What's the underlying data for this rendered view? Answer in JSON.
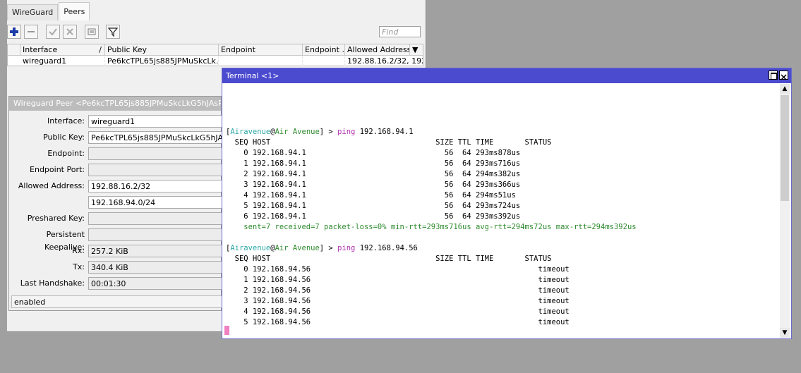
{
  "tabs": [
    "WireGuard",
    "Peers"
  ],
  "active_tab": "Peers",
  "toolbar": {
    "find_placeholder": "Find"
  },
  "table": {
    "columns": [
      "Interface",
      "Public Key",
      "Endpoint",
      "Endpoint ...",
      "Allowed Address"
    ],
    "rows": [
      [
        "wireguard1",
        "Pe6kcTPL65js885JPMuSkcLk...",
        "",
        "",
        "192.88.16.2/32, 192..."
      ]
    ]
  },
  "peer": {
    "title": "Wireguard Peer <Pe6kcTPL65js885JPMuSkcLkG5hJAsR3el/",
    "fields": [
      {
        "label": "Interface:",
        "value": "wireguard1"
      },
      {
        "label": "Public Key:",
        "value": "Pe6kcTPL65js885JPMuSkcLkG5hJAsR"
      },
      {
        "label": "Endpoint:",
        "value": ""
      },
      {
        "label": "Endpoint Port:",
        "value": ""
      },
      {
        "label": "Allowed Address:",
        "value": "192.88.16.2/32"
      },
      {
        "label": "",
        "value": "192.168.94.0/24"
      },
      {
        "label": "Preshared Key:",
        "value": ""
      },
      {
        "label": "Persistent Keepalive:",
        "value": ""
      },
      {
        "label": "Rx:",
        "value": "257.2 KiB"
      },
      {
        "label": "Tx:",
        "value": "340.4 KiB"
      },
      {
        "label": "Last Handshake:",
        "value": "00:01:30"
      }
    ],
    "status": "enabled"
  },
  "terminal": {
    "title": "Terminal <1>",
    "prompt_user": "Airavenue",
    "prompt_host": "Air Avenue",
    "cmd1": "ping 192.168.94.1",
    "header1": "  SEQ HOST                                     SIZE TTL TIME       STATUS",
    "rows1": [
      "    0 192.168.94.1                               56  64 293ms878us",
      "    1 192.168.94.1                               56  64 293ms716us",
      "    2 192.168.94.1                               56  64 294ms382us",
      "    3 192.168.94.1                               56  64 293ms366us",
      "    4 192.168.94.1                               56  64 294ms51us",
      "    5 192.168.94.1                               56  64 293ms724us",
      "    6 192.168.94.1                               56  64 293ms392us"
    ],
    "summary": "    sent=7 received=7 packet-loss=0% min-rtt=293ms716us avg-rtt=294ms72us max-rtt=294ms392us",
    "cmd2": "ping 192.168.94.56",
    "header2": "  SEQ HOST                                     SIZE TTL TIME       STATUS",
    "rows2": [
      "    0 192.168.94.56                                                   timeout",
      "    1 192.168.94.56                                                   timeout",
      "    2 192.168.94.56                                                   timeout",
      "    3 192.168.94.56                                                   timeout",
      "    4 192.168.94.56                                                   timeout",
      "    5 192.168.94.56                                                   timeout"
    ]
  }
}
